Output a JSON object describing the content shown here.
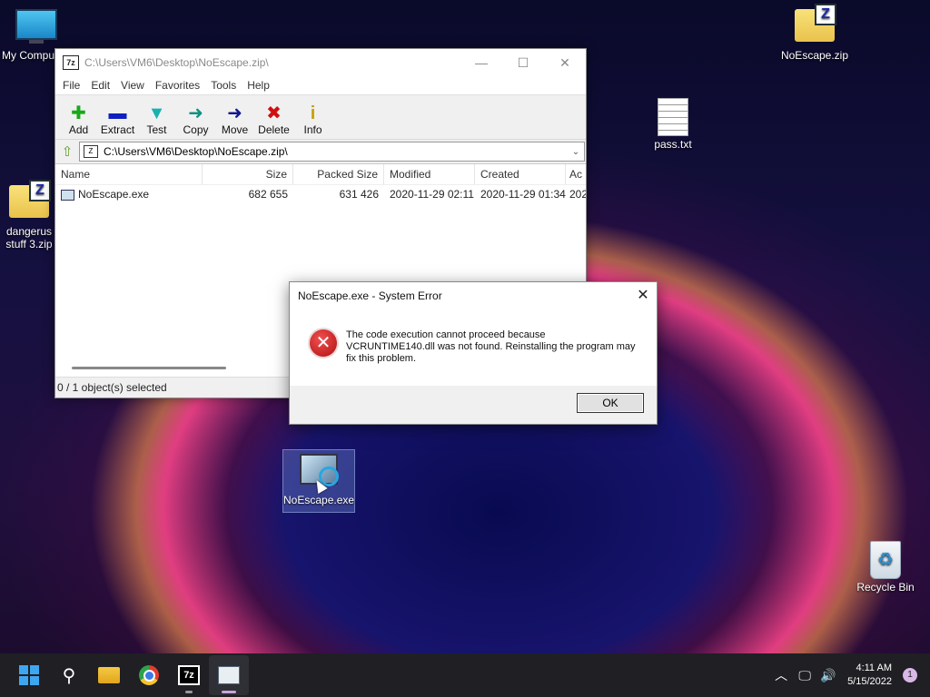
{
  "desktop": {
    "icons": [
      {
        "label": "My Compu",
        "icon": "computer-icon"
      },
      {
        "label": "NoEscape.zip",
        "icon": "zip-folder-icon"
      },
      {
        "label": "pass.txt",
        "icon": "text-file-icon"
      },
      {
        "label": "dangerus stuff 3.zip",
        "line1": "dangerus",
        "line2": "stuff 3.zip",
        "icon": "zip-folder-icon"
      },
      {
        "label": "NoEscape.exe",
        "icon": "exe-icon"
      },
      {
        "label": "Recycle Bin",
        "icon": "recycle-bin-icon"
      }
    ]
  },
  "window7z": {
    "title": "C:\\Users\\VM6\\Desktop\\NoEscape.zip\\",
    "app_icon_text": "7z",
    "menu": [
      "File",
      "Edit",
      "View",
      "Favorites",
      "Tools",
      "Help"
    ],
    "toolbar": [
      {
        "label": "Add",
        "icon": "plus-icon",
        "color": "#18a818"
      },
      {
        "label": "Extract",
        "icon": "minus-icon",
        "color": "#1020c0"
      },
      {
        "label": "Test",
        "icon": "check-icon",
        "color": "#18b0b0"
      },
      {
        "label": "Copy",
        "icon": "arrow-right-icon",
        "color": "#109080"
      },
      {
        "label": "Move",
        "icon": "arrow-right-icon",
        "color": "#101890"
      },
      {
        "label": "Delete",
        "icon": "x-icon",
        "color": "#d01010"
      },
      {
        "label": "Info",
        "icon": "info-icon",
        "color": "#c8a000"
      }
    ],
    "address": "C:\\Users\\VM6\\Desktop\\NoEscape.zip\\",
    "columns": [
      "Name",
      "Size",
      "Packed Size",
      "Modified",
      "Created",
      "Ac"
    ],
    "rows": [
      {
        "name": "NoEscape.exe",
        "size": "682 655",
        "packed": "631 426",
        "modified": "2020-11-29 02:11",
        "created": "2020-11-29 01:34",
        "ac": "202"
      }
    ],
    "status": "0 / 1 object(s) selected"
  },
  "dialog": {
    "title": "NoEscape.exe - System Error",
    "message": "The code execution cannot proceed because VCRUNTIME140.dll was not found. Reinstalling the program may fix this problem.",
    "ok_label": "OK"
  },
  "taskbar": {
    "apps": [
      "start-icon",
      "search-icon",
      "file-explorer-icon",
      "chrome-icon",
      "7zip-icon",
      "noescape-app-icon"
    ],
    "app_7z_text": "7z",
    "time": "4:11 AM",
    "date": "5/15/2022",
    "notifications": "1"
  }
}
